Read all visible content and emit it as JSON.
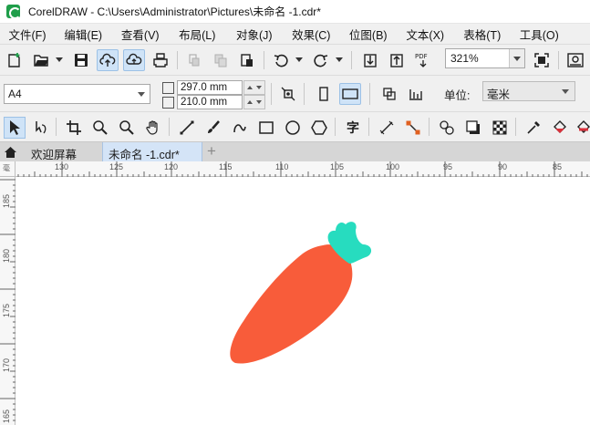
{
  "window": {
    "title": "CorelDRAW - C:\\Users\\Administrator\\Pictures\\未命名 -1.cdr*"
  },
  "menu": [
    {
      "label": "文件(F)",
      "name": "menu-file"
    },
    {
      "label": "编辑(E)",
      "name": "menu-edit"
    },
    {
      "label": "查看(V)",
      "name": "menu-view"
    },
    {
      "label": "布局(L)",
      "name": "menu-layout"
    },
    {
      "label": "对象(J)",
      "name": "menu-object"
    },
    {
      "label": "效果(C)",
      "name": "menu-effects"
    },
    {
      "label": "位图(B)",
      "name": "menu-bitmaps"
    },
    {
      "label": "文本(X)",
      "name": "menu-text"
    },
    {
      "label": "表格(T)",
      "name": "menu-table"
    },
    {
      "label": "工具(O)",
      "name": "menu-tools"
    }
  ],
  "standard_toolbar": {
    "zoom_value": "321%",
    "pdf_label": "PDF"
  },
  "property_bar": {
    "page_size": "A4",
    "width": "297.0 mm",
    "height": "210.0 mm",
    "units_label": "单位:",
    "units_value": "毫米"
  },
  "text_tool_glyph": "字",
  "tabs": {
    "welcome": "欢迎屏幕",
    "current": "未命名 -1.cdr*",
    "add": "+"
  },
  "ruler": {
    "horizontal_labels": [
      "130",
      "125",
      "120",
      "115",
      "110",
      "105",
      "100",
      "95",
      "90",
      "85"
    ],
    "vertical_labels": [
      "185",
      "180",
      "175",
      "170",
      "165"
    ],
    "unit_glyph": "毫"
  },
  "colors": {
    "carrot_body": "#f85c3a",
    "carrot_leaves": "#27dcbf",
    "active_tab": "#d4e4f7",
    "toggle_highlight": "#cfe3f7"
  }
}
